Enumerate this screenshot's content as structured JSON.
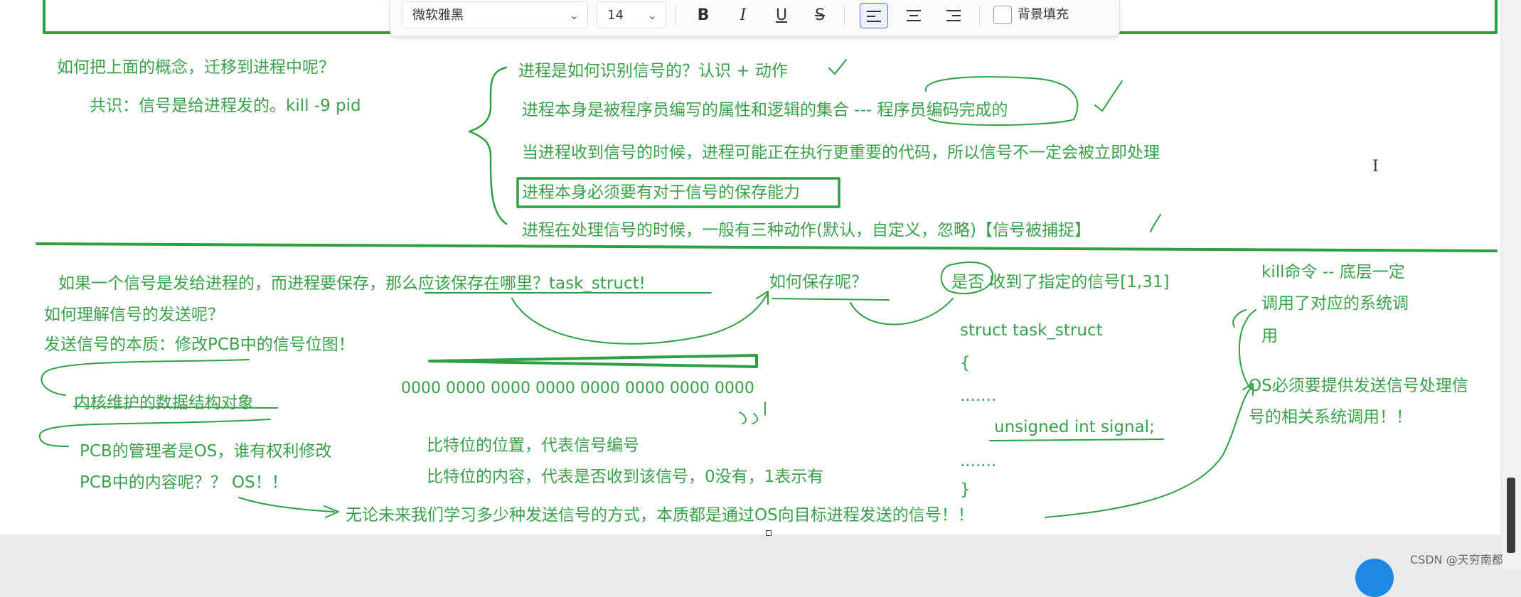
{
  "toolbar": {
    "font_name": "微软雅黑",
    "font_size": "14",
    "bold": "B",
    "italic": "I",
    "underline": "U",
    "strike": "S",
    "fill_label": "背景填充",
    "fill_checked": false
  },
  "top_section": {
    "q_concept": "如何把上面的概念，迁移到进程中呢？",
    "consensus": "共识：信号是给进程发的。kill -9 pid",
    "item1": "进程是如何识别信号的？认识 + 动作",
    "item2": "进程本身是被程序员编写的属性和逻辑的集合 --- 程序员编码完成的",
    "item3": "当进程收到信号的时候，进程可能正在执行更重要的代码，所以信号不一定会被立即处理",
    "item4": "进程本身必须要有对于信号的保存能力",
    "item5": "进程在处理信号的时候，一般有三种动作(默认，自定义，忽略)【信号被捕捉】"
  },
  "bottom_section": {
    "q_where": "如果一个信号是发给进程的，而进程要保存，那么应该保存在哪里？task_struct!",
    "q_how_save": "如何保存呢？",
    "received": "是否 收到了指定的信号[1,31]",
    "q_send": "如何理解信号的发送呢？",
    "send_essence": "发送信号的本质：修改PCB中的信号位图！",
    "kernel_ds": "内核维护的数据结构对象",
    "pcb_manager_1": "PCB的管理者是OS，谁有权利修改",
    "pcb_manager_2": "PCB中的内容呢？？ OS！！",
    "bitmap": "0000 0000 0000 0000 0000 0000 0000 0000",
    "bit_pos": "比特位的位置，代表信号编号",
    "bit_content": "比特位的内容，代表是否收到该信号，0没有，1表示有",
    "conclusion": "无论未来我们学习多少种发送信号的方式，本质都是通过OS向目标进程发送的信号！！",
    "struct_line1": "struct task_struct",
    "struct_line2": "{",
    "struct_line3": ".......",
    "struct_line4": "unsigned int signal;",
    "struct_line5": ".......",
    "struct_line6": "}",
    "kill_cmd_1": "kill命令 -- 底层一定",
    "kill_cmd_2": "调用了对应的系统调",
    "kill_cmd_3": "用",
    "os_provide_1": "OS必须要提供发送信号处理信",
    "os_provide_2": "号的相关系统调用！！"
  },
  "watermark": "CSDN @天穷南都",
  "colors": {
    "ink": "#3aa14a",
    "accent": "#2ea043",
    "toolbar_active": "#4a6fd6"
  },
  "icons": [
    "chevron-down-icon",
    "align-left-icon",
    "align-center-icon",
    "align-right-icon",
    "text-cursor-icon"
  ]
}
